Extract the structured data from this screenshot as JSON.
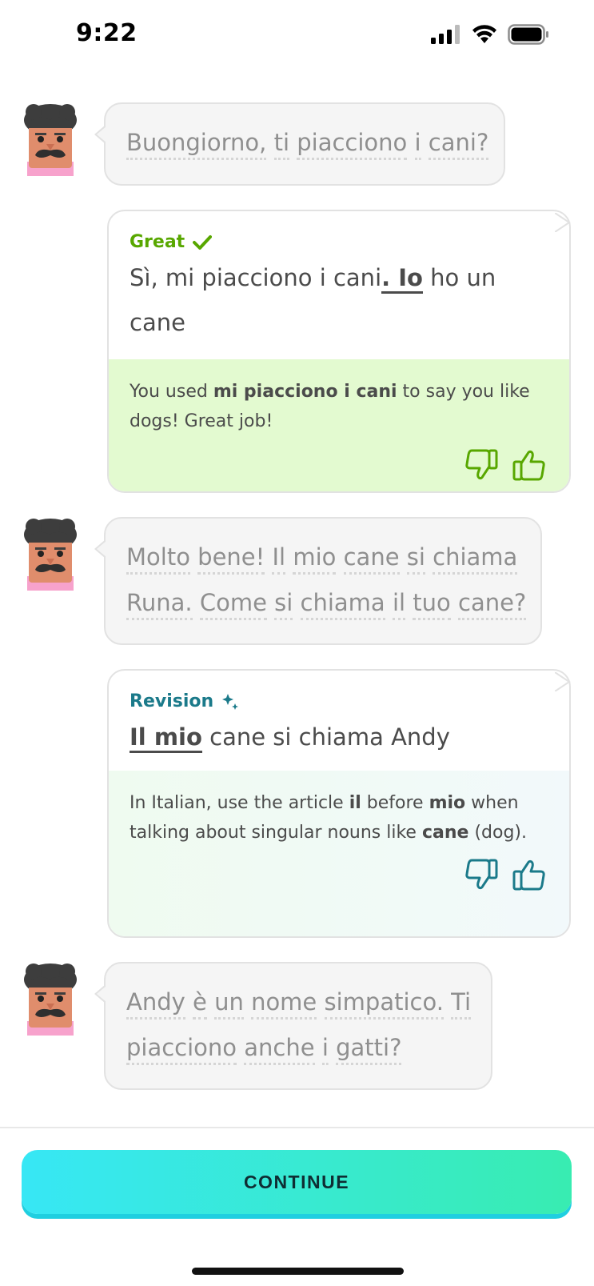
{
  "status_bar": {
    "time": "9:22"
  },
  "conversation": [
    {
      "type": "character",
      "lines": [
        [
          "Buongiorno,",
          "ti",
          "piacciono",
          "i",
          "cani?"
        ]
      ]
    },
    {
      "type": "response",
      "status": "Great",
      "text_parts": [
        "Sì, mi piacciono i cani",
        ". Io",
        " ho un cane"
      ],
      "feedback_parts": [
        "You used ",
        "mi piacciono i cani",
        " to say you like dogs! Great job!"
      ]
    },
    {
      "type": "character",
      "lines": [
        [
          "Molto",
          "bene!",
          "Il",
          "mio",
          "cane",
          "si",
          "chiama"
        ],
        [
          "Runa.",
          "Come",
          "si",
          "chiama",
          "il",
          "tuo",
          "cane?"
        ]
      ]
    },
    {
      "type": "response",
      "status": "Revision",
      "text_parts": [
        "Il mio",
        " cane si chiama Andy"
      ],
      "feedback_parts": [
        "In Italian, use the article ",
        "il",
        " before ",
        "mio",
        " when talking about singular nouns like ",
        "cane",
        " (dog)."
      ]
    },
    {
      "type": "character",
      "lines": [
        [
          "Andy",
          "è",
          "un",
          "nome",
          "simpatico.",
          "Ti"
        ],
        [
          "piacciono",
          "anche",
          "i",
          "gatti?"
        ]
      ]
    }
  ],
  "footer": {
    "continue_label": "CONTINUE"
  },
  "colors": {
    "great": "#58a700",
    "revision": "#1b7a8a",
    "great_bg": "#e3fad0",
    "button_start": "#37e7f5",
    "button_end": "#38ecb1"
  },
  "icons": [
    "avatar-oscar-icon",
    "checkmark-icon",
    "sparkle-icon",
    "thumbs-down-icon",
    "thumbs-up-icon",
    "cellular-signal-icon",
    "wifi-icon",
    "battery-icon"
  ]
}
